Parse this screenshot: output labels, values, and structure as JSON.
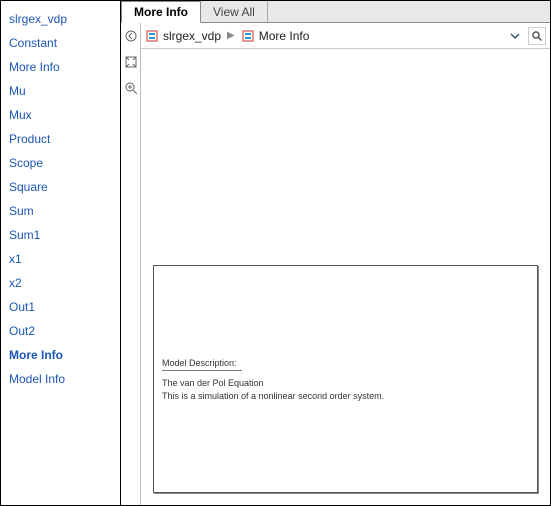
{
  "sidebar": {
    "items": [
      {
        "label": "slrgex_vdp",
        "active": false
      },
      {
        "label": "Constant",
        "active": false
      },
      {
        "label": "More Info",
        "active": false
      },
      {
        "label": "Mu",
        "active": false
      },
      {
        "label": "Mux",
        "active": false
      },
      {
        "label": "Product",
        "active": false
      },
      {
        "label": "Scope",
        "active": false
      },
      {
        "label": "Square",
        "active": false
      },
      {
        "label": "Sum",
        "active": false
      },
      {
        "label": "Sum1",
        "active": false
      },
      {
        "label": "x1",
        "active": false
      },
      {
        "label": "x2",
        "active": false
      },
      {
        "label": "Out1",
        "active": false
      },
      {
        "label": "Out2",
        "active": false
      },
      {
        "label": "More Info",
        "active": true
      },
      {
        "label": "Model Info",
        "active": false
      }
    ]
  },
  "tabs": [
    {
      "label": "More Info",
      "active": true
    },
    {
      "label": "View All",
      "active": false
    }
  ],
  "breadcrumb": {
    "root": "slrgex_vdp",
    "current": "More Info"
  },
  "model_info": {
    "heading": "Model Description:",
    "line1": "The van der Pol Equation",
    "line2": "This is a simulation of a nonlinear second order system."
  }
}
